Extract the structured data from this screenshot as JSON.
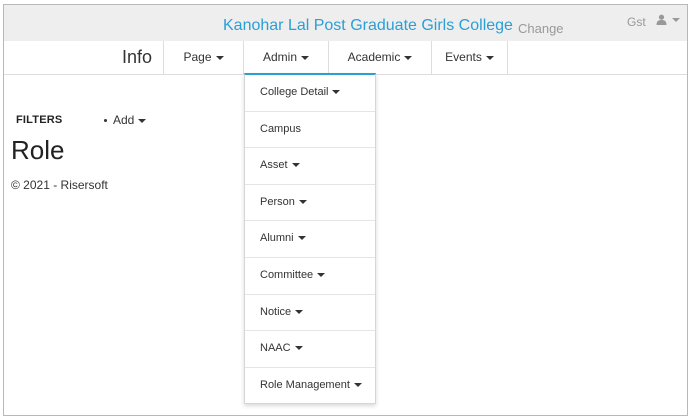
{
  "header": {
    "college_name": "Kanohar Lal Post Graduate Girls College",
    "change_label": "Change",
    "user_name": "Gst",
    "user_icon": "user-icon"
  },
  "nav": {
    "brand": "Info",
    "items": [
      {
        "label": "Page"
      },
      {
        "label": "Admin"
      },
      {
        "label": "Academic"
      },
      {
        "label": "Events"
      }
    ]
  },
  "admin_dropdown": {
    "items": [
      {
        "label": "College Detail",
        "has_submenu": true
      },
      {
        "label": "Campus",
        "has_submenu": false
      },
      {
        "label": "Asset",
        "has_submenu": true
      },
      {
        "label": "Person",
        "has_submenu": true
      },
      {
        "label": "Alumni",
        "has_submenu": true
      },
      {
        "label": "Committee",
        "has_submenu": true
      },
      {
        "label": "Notice",
        "has_submenu": true
      },
      {
        "label": "NAAC",
        "has_submenu": true
      },
      {
        "label": "Role Management",
        "has_submenu": true
      }
    ]
  },
  "toolbar": {
    "filters_label": "FILTERS",
    "add_label": "Add"
  },
  "page": {
    "title": "Role",
    "footer": "© 2021 - Risersoft"
  },
  "colors": {
    "accent": "#2a9fd6",
    "topbar_bg": "#eeeeee",
    "muted": "#999999"
  }
}
